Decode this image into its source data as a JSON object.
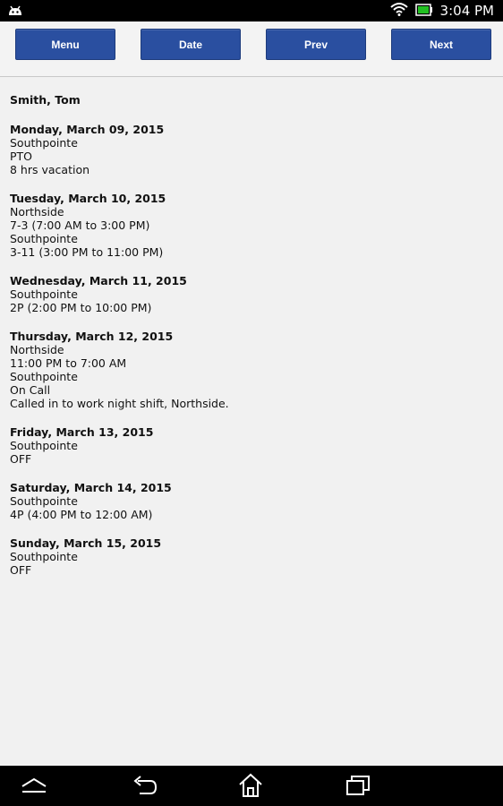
{
  "status_bar": {
    "time": "3:04 PM",
    "icons": [
      "android-icon",
      "wifi-icon",
      "battery-icon"
    ]
  },
  "toolbar": {
    "menu_label": "Menu",
    "date_label": "Date",
    "prev_label": "Prev",
    "next_label": "Next"
  },
  "schedule": {
    "employee": "Smith, Tom",
    "days": [
      {
        "title": "Monday, March 09, 2015",
        "lines": [
          "Southpointe",
          "PTO",
          "8 hrs vacation"
        ]
      },
      {
        "title": "Tuesday, March 10, 2015",
        "lines": [
          "Northside",
          "7-3 (7:00 AM to 3:00 PM)",
          "Southpointe",
          "3-11 (3:00 PM to 11:00 PM)"
        ]
      },
      {
        "title": "Wednesday, March 11, 2015",
        "lines": [
          "Southpointe",
          "2P (2:00 PM to 10:00 PM)"
        ]
      },
      {
        "title": "Thursday, March 12, 2015",
        "lines": [
          "Northside",
          "11:00 PM to 7:00 AM",
          "Southpointe",
          "On Call",
          "Called in to work night shift, Northside."
        ]
      },
      {
        "title": "Friday, March 13, 2015",
        "lines": [
          "Southpointe",
          "OFF"
        ]
      },
      {
        "title": "Saturday, March 14, 2015",
        "lines": [
          "Southpointe",
          "4P (4:00 PM to 12:00 AM)"
        ]
      },
      {
        "title": "Sunday, March 15, 2015",
        "lines": [
          "Southpointe",
          "OFF"
        ]
      }
    ]
  },
  "nav_bar": {
    "icons": [
      "collapse-icon",
      "back-icon",
      "home-icon",
      "recent-apps-icon"
    ]
  },
  "colors": {
    "button": "#2a4fa0",
    "background": "#f1f1f1",
    "battery": "#22c022"
  }
}
